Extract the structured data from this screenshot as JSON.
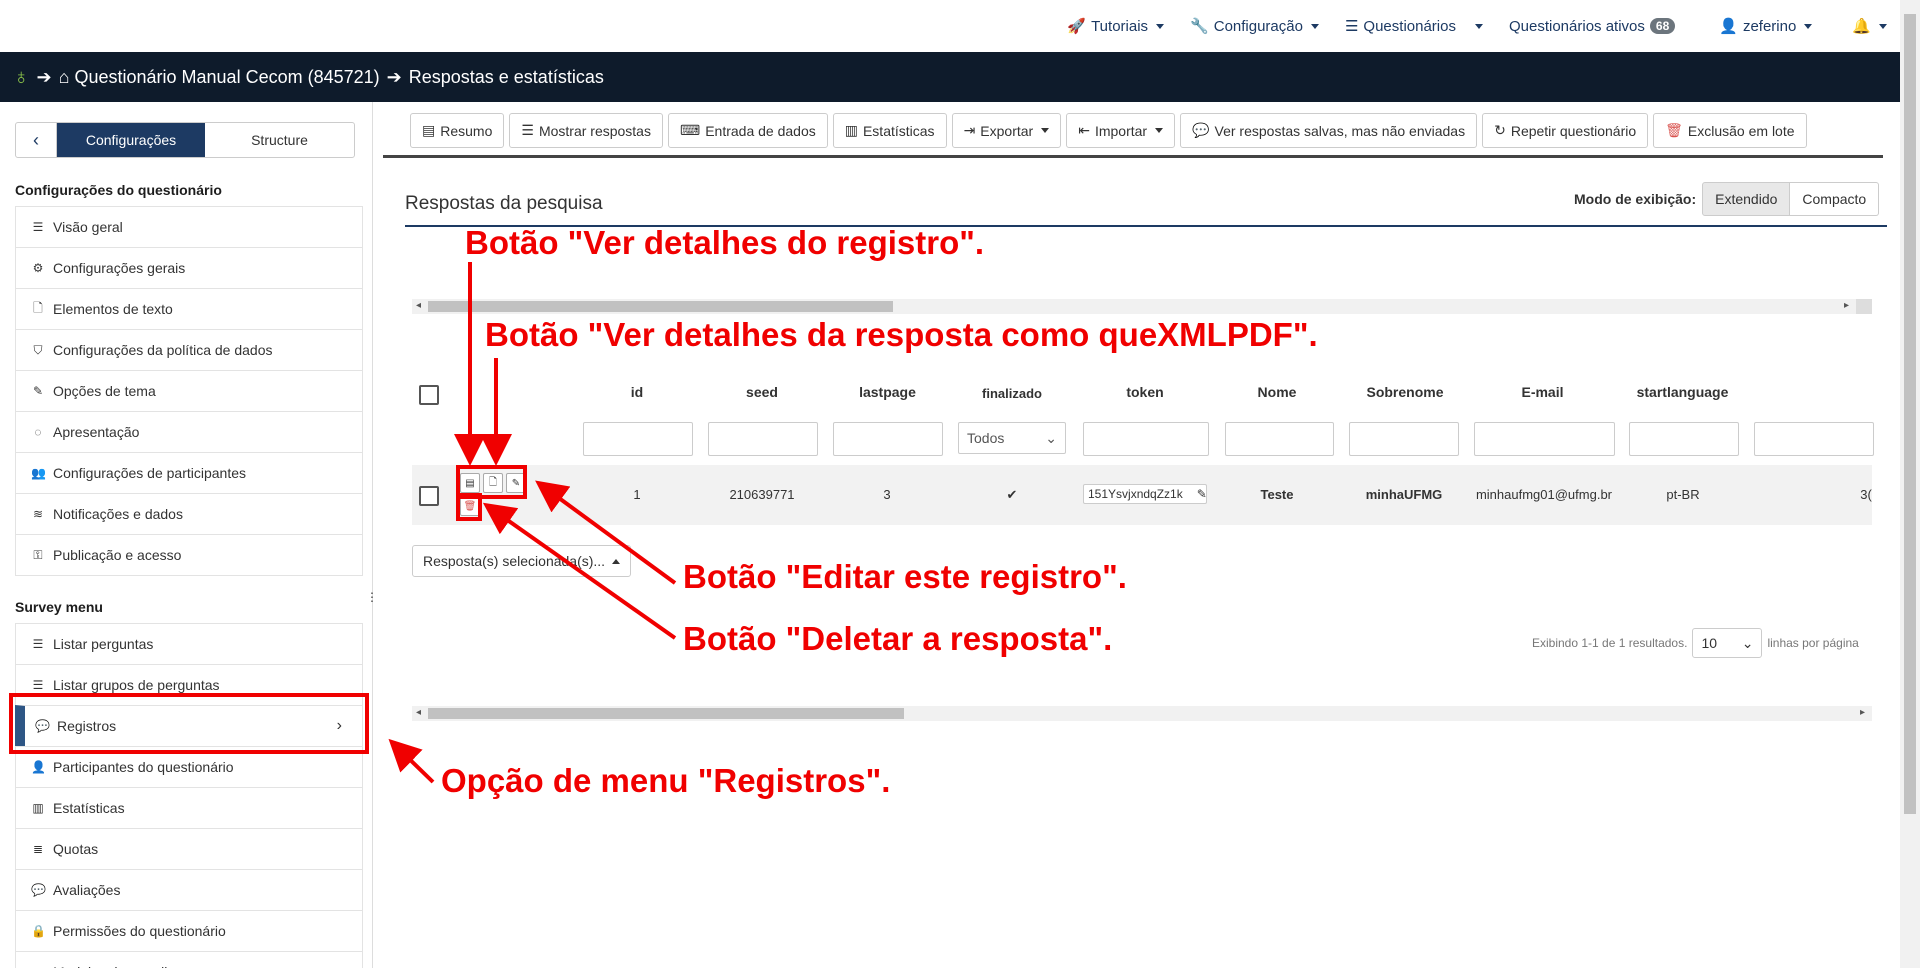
{
  "topnav": {
    "tutorials": "Tutoriais",
    "config": "Configuração",
    "surveys": "Questionários",
    "active": "Questionários ativos",
    "active_count": "68",
    "user": "zeferino"
  },
  "breadcrumb": {
    "survey": "Questionário Manual Cecom (845721)",
    "page": "Respostas e estatísticas"
  },
  "sidebar": {
    "tab_active": "Configurações",
    "tab_inactive": "Structure",
    "section1": "Configurações do questionário",
    "items1": [
      {
        "label": "Visão geral",
        "icon": "list-icon"
      },
      {
        "label": "Configurações gerais",
        "icon": "gears-icon"
      },
      {
        "label": "Elementos de texto",
        "icon": "file-icon"
      },
      {
        "label": "Configurações da política de dados",
        "icon": "shield-icon"
      },
      {
        "label": "Opções de tema",
        "icon": "brush-icon"
      },
      {
        "label": "Apresentação",
        "icon": "eye-slash-icon"
      },
      {
        "label": "Configurações de participantes",
        "icon": "users-icon"
      },
      {
        "label": "Notificações e dados",
        "icon": "rss-icon"
      },
      {
        "label": "Publicação e acesso",
        "icon": "key-icon"
      }
    ],
    "section2": "Survey menu",
    "items2": [
      {
        "label": "Listar perguntas",
        "icon": "list-icon"
      },
      {
        "label": "Listar grupos de perguntas",
        "icon": "list-icon"
      },
      {
        "label": "Registros",
        "icon": "comment-icon"
      },
      {
        "label": "Participantes do questionário",
        "icon": "user-icon"
      },
      {
        "label": "Estatísticas",
        "icon": "bar-chart-icon"
      },
      {
        "label": "Quotas",
        "icon": "tasks-icon"
      },
      {
        "label": "Avaliações",
        "icon": "comment-icon"
      },
      {
        "label": "Permissões do questionário",
        "icon": "lock-icon"
      },
      {
        "label": "Modelos de e-mail",
        "icon": "envelope-icon"
      }
    ]
  },
  "toolbar": {
    "summary": "Resumo",
    "show": "Mostrar respostas",
    "entry": "Entrada de dados",
    "stats": "Estatísticas",
    "export": "Exportar",
    "import": "Importar",
    "saved": "Ver respostas salvas, mas não enviadas",
    "repeat": "Repetir questionário",
    "batch_delete": "Exclusão em lote"
  },
  "panel": {
    "title": "Respostas da pesquisa",
    "view_mode_label": "Modo de exibição:",
    "extended": "Extendido",
    "compact": "Compacto"
  },
  "table": {
    "headers": [
      "id",
      "seed",
      "lastpage",
      "finalizado",
      "token",
      "Nome",
      "Sobrenome",
      "E-mail",
      "startlanguage"
    ],
    "filter_all": "Todos",
    "row": {
      "id": "1",
      "seed": "210639771",
      "lastpage": "3",
      "token": "151YsvjxndqZz1k",
      "nome": "Teste",
      "sobrenome": "minhaUFMG",
      "email": "minhaufmg01@ufmg.br",
      "lang": "pt-BR",
      "extra": "3("
    },
    "selected_btn": "Resposta(s) selecionada(s)...",
    "pager_text": "Exibindo 1-1 de 1 resultados.",
    "page_size": "10",
    "per_page": "linhas por página"
  },
  "annotations": {
    "view_details": "Botão \"Ver detalhes do registro\".",
    "queXML": "Botão \"Ver detalhes da resposta como queXMLPDF\".",
    "edit": "Botão \"Editar este registro\".",
    "delete": "Botão \"Deletar a resposta\".",
    "menu": "Opção de menu \"Registros\".",
    "color": "#f00000"
  }
}
